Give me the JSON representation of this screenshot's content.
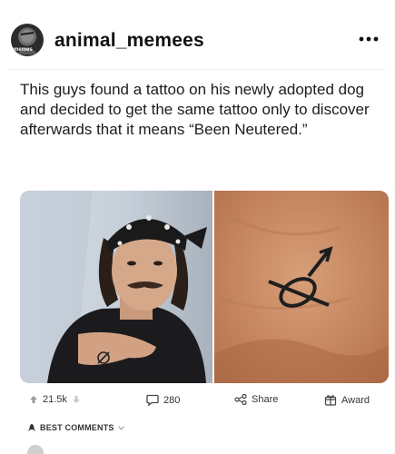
{
  "post": {
    "username": "animal_memees",
    "avatar_text": "memes",
    "more_icon": "more-horizontal-icon",
    "caption": "This guys found a tattoo on his newly adopted dog and decided to get the same tattoo only to discover afterwards that it means “Been Neutered.”"
  },
  "actions": {
    "upvotes": "21.5k",
    "comments": "280",
    "share_label": "Share",
    "award_label": "Award"
  },
  "comments_section": {
    "sort_label": "BEST COMMENTS"
  },
  "colors": {
    "accent_text": "#111111",
    "muted": "#8a8a8a"
  }
}
